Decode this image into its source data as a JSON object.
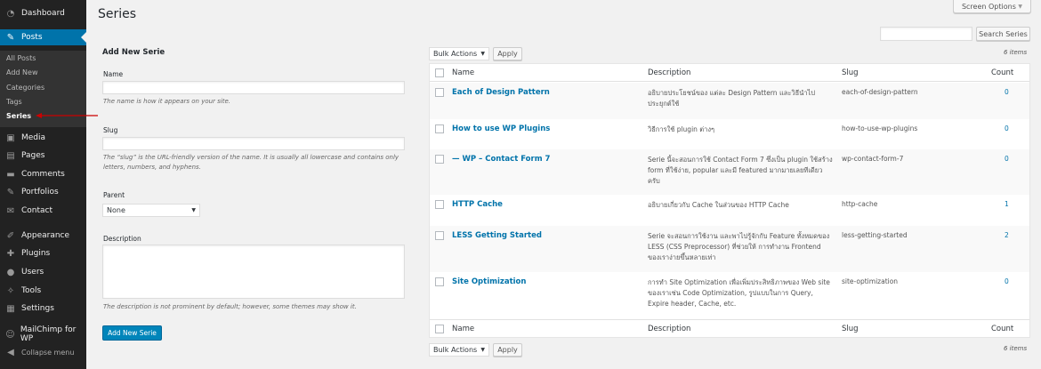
{
  "sidebar": {
    "items": [
      {
        "label": "Dashboard",
        "icon": "dashboard-icon"
      },
      {
        "label": "Posts",
        "icon": "pin-icon"
      },
      {
        "label": "Media",
        "icon": "media-icon"
      },
      {
        "label": "Pages",
        "icon": "page-icon"
      },
      {
        "label": "Comments",
        "icon": "comment-icon"
      },
      {
        "label": "Portfolios",
        "icon": "pin-icon"
      },
      {
        "label": "Contact",
        "icon": "mail-icon"
      },
      {
        "label": "Appearance",
        "icon": "brush-icon"
      },
      {
        "label": "Plugins",
        "icon": "plugin-icon"
      },
      {
        "label": "Users",
        "icon": "user-icon"
      },
      {
        "label": "Tools",
        "icon": "wrench-icon"
      },
      {
        "label": "Settings",
        "icon": "settings-icon"
      },
      {
        "label": "MailChimp for WP",
        "icon": "mailchimp-icon"
      },
      {
        "label": "Collapse menu",
        "icon": "collapse-icon"
      }
    ],
    "submenu": [
      "All Posts",
      "Add New",
      "Categories",
      "Tags",
      "Series"
    ]
  },
  "page": {
    "title": "Series",
    "screen_options": "Screen Options",
    "search_button": "Search Series"
  },
  "form": {
    "heading": "Add New Serie",
    "name_label": "Name",
    "name_help": "The name is how it appears on your site.",
    "slug_label": "Slug",
    "slug_help": "The “slug” is the URL-friendly version of the name. It is usually all lowercase and contains only letters, numbers, and hyphens.",
    "parent_label": "Parent",
    "parent_value": "None",
    "description_label": "Description",
    "description_help": "The description is not prominent by default; however, some themes may show it.",
    "submit": "Add New Serie"
  },
  "list": {
    "bulk_actions": "Bulk Actions",
    "apply": "Apply",
    "item_count": "6 items",
    "columns": [
      "Name",
      "Description",
      "Slug",
      "Count"
    ],
    "rows": [
      {
        "name": "Each of Design Pattern",
        "description": "อธิบายประโยชน์ของ แต่ละ Design Pattern และวิธีนำไปประยุกต์ใช้",
        "slug": "each-of-design-pattern",
        "count": "0"
      },
      {
        "name": "How to use WP Plugins",
        "description": "วิธีการใช้ plugin ต่างๆ",
        "slug": "how-to-use-wp-plugins",
        "count": "0"
      },
      {
        "name": "— WP – Contact Form 7",
        "description": "Serie นี้จะสอนการใช้ Contact Form 7 ซึ่งเป็น plugin ใช้สร้าง form ที่ใช้ง่าย, popular และมี featured มากมายเลยทีเดียวครับ",
        "slug": "wp-contact-form-7",
        "count": "0"
      },
      {
        "name": "HTTP Cache",
        "description": "อธิบายเกี่ยวกับ Cache ในส่วนของ HTTP Cache",
        "slug": "http-cache",
        "count": "1"
      },
      {
        "name": "LESS Getting Started",
        "description": "Serie จะสอนการใช้งาน และพาไปรู้จักกับ Feature ทั้งหมดของ LESS (CSS Preprocessor) ที่ช่วยให้ การทำงาน Frontend ของเราง่ายขึ้นหลายเท่า",
        "slug": "less-getting-started",
        "count": "2"
      },
      {
        "name": "Site Optimization",
        "description": "การทำ Site Optimization เพื่อเพิ่มประสิทธิภาพของ Web site ของเราเช่น Code Optimization, รูปแบบในการ Query, Expire header, Cache, etc.",
        "slug": "site-optimization",
        "count": "0"
      }
    ]
  },
  "colors": {
    "accent": "#0073aa",
    "sidebar_bg": "#222222",
    "annotation": "#cc0000"
  }
}
